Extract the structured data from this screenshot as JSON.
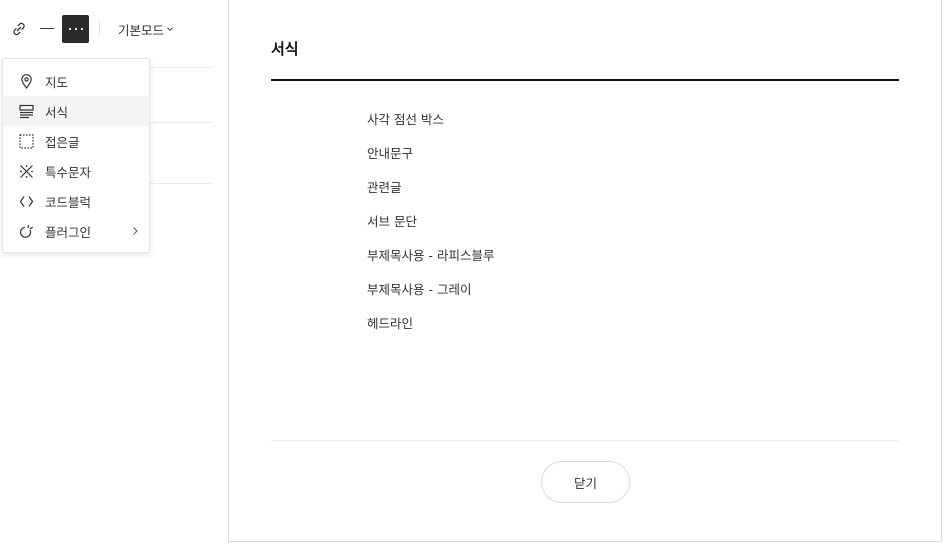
{
  "toolbar": {
    "mode_label": "기본모드"
  },
  "menu": {
    "items": [
      {
        "label": "지도",
        "icon": "map-pin-icon"
      },
      {
        "label": "서식",
        "icon": "format-lines-icon"
      },
      {
        "label": "접은글",
        "icon": "dashed-box-icon"
      },
      {
        "label": "특수문자",
        "icon": "special-char-icon"
      },
      {
        "label": "코드블럭",
        "icon": "code-brackets-icon"
      },
      {
        "label": "플러그인",
        "icon": "plugin-icon"
      }
    ]
  },
  "panel": {
    "title": "서식",
    "options": [
      "사각 점선 박스",
      "안내문구",
      "관련글",
      "서브 문단",
      "부제목사용 - 라피스블루",
      "부제목사용 - 그레이",
      "헤드라인"
    ],
    "close_label": "닫기"
  }
}
